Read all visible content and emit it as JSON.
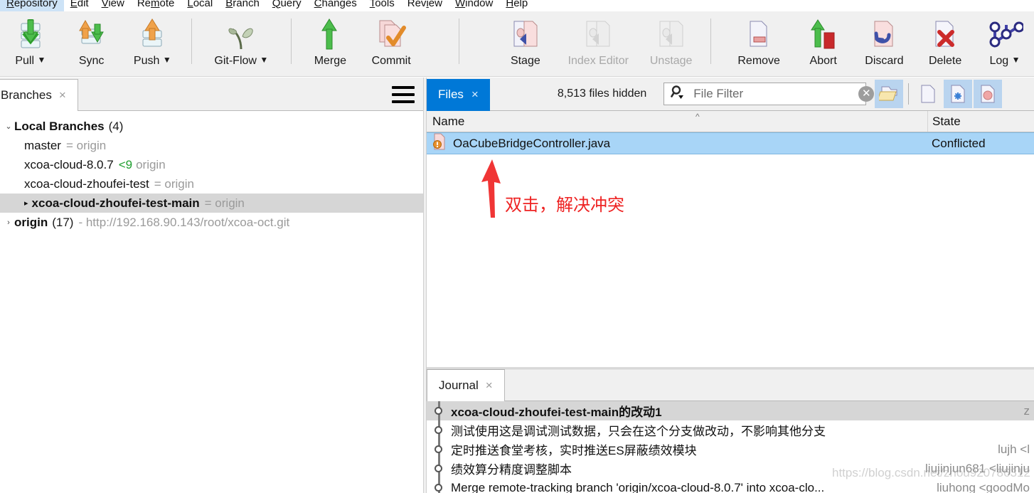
{
  "menubar": {
    "items": [
      {
        "label": "Repository",
        "mnemonic": "R",
        "active": true
      },
      {
        "label": "Edit",
        "mnemonic": "E",
        "active": false
      },
      {
        "label": "View",
        "mnemonic": "V",
        "active": false
      },
      {
        "label": "Remote",
        "mnemonic": "m",
        "active": false
      },
      {
        "label": "Local",
        "mnemonic": "L",
        "active": false
      },
      {
        "label": "Branch",
        "mnemonic": "B",
        "active": false
      },
      {
        "label": "Query",
        "mnemonic": "Q",
        "active": false
      },
      {
        "label": "Changes",
        "mnemonic": "C",
        "active": false
      },
      {
        "label": "Tools",
        "mnemonic": "T",
        "active": false
      },
      {
        "label": "Review",
        "mnemonic": "i",
        "active": false
      },
      {
        "label": "Window",
        "mnemonic": "W",
        "active": false
      },
      {
        "label": "Help",
        "mnemonic": "H",
        "active": false
      }
    ]
  },
  "toolbar": {
    "buttons": [
      {
        "label": "Pull",
        "icon": "pull-icon",
        "dropdown": true,
        "enabled": true
      },
      {
        "label": "Sync",
        "icon": "sync-icon",
        "dropdown": false,
        "enabled": true
      },
      {
        "label": "Push",
        "icon": "push-icon",
        "dropdown": true,
        "enabled": true
      },
      {
        "label": "Git-Flow",
        "icon": "git-flow-icon",
        "dropdown": true,
        "enabled": true
      },
      {
        "label": "Merge",
        "icon": "merge-icon",
        "dropdown": false,
        "enabled": true
      },
      {
        "label": "Commit",
        "icon": "commit-icon",
        "dropdown": false,
        "enabled": true
      },
      {
        "label": "Stage",
        "icon": "stage-icon",
        "dropdown": false,
        "enabled": true
      },
      {
        "label": "Index Editor",
        "icon": "index-editor-icon",
        "dropdown": false,
        "enabled": false
      },
      {
        "label": "Unstage",
        "icon": "unstage-icon",
        "dropdown": false,
        "enabled": false
      },
      {
        "label": "Remove",
        "icon": "remove-icon",
        "dropdown": false,
        "enabled": true
      },
      {
        "label": "Abort",
        "icon": "abort-icon",
        "dropdown": false,
        "enabled": true
      },
      {
        "label": "Discard",
        "icon": "discard-icon",
        "dropdown": false,
        "enabled": true
      },
      {
        "label": "Delete",
        "icon": "delete-icon",
        "dropdown": false,
        "enabled": true
      },
      {
        "label": "Log",
        "icon": "log-icon",
        "dropdown": true,
        "enabled": true
      }
    ]
  },
  "branches_panel": {
    "tab": {
      "label": "Branches",
      "close": "×"
    },
    "menu_icon": "hamburger-menu-icon",
    "groups": [
      {
        "label": "Local Branches",
        "count": "(4)",
        "expanded": true,
        "twisty": "⌄",
        "items": [
          {
            "name": "master",
            "tracking": "= origin",
            "ahead": "",
            "selected": false,
            "current": false
          },
          {
            "name": "xcoa-cloud-8.0.7",
            "tracking": "origin",
            "ahead": "<9",
            "selected": false,
            "current": false
          },
          {
            "name": "xcoa-cloud-zhoufei-test",
            "tracking": "= origin",
            "ahead": "",
            "selected": false,
            "current": false
          },
          {
            "name": "xcoa-cloud-zhoufei-test-main",
            "tracking": "= origin",
            "ahead": "",
            "selected": true,
            "current": true
          }
        ]
      }
    ],
    "remote": {
      "label": "origin",
      "count": "(17)",
      "url": "- http://192.168.90.143/root/xcoa-oct.git",
      "twisty": "›"
    }
  },
  "files_panel": {
    "tab": {
      "label": "Files",
      "close": "×"
    },
    "hidden_files": "8,513 files hidden",
    "filter": {
      "placeholder": "File Filter",
      "value": "",
      "search_icon": "search-icon",
      "clear_icon": "clear-circle-icon"
    },
    "view_buttons": [
      {
        "name": "open-folder-icon",
        "active": true
      },
      {
        "name": "blank-file-icon",
        "active": false
      },
      {
        "name": "new-file-icon",
        "active": true
      },
      {
        "name": "modified-file-icon",
        "active": true
      }
    ],
    "columns": [
      {
        "label": "Name",
        "sorted": true,
        "sort_caret": "^"
      },
      {
        "label": "State",
        "sorted": false
      }
    ],
    "rows": [
      {
        "name": "OaCubeBridgeController.java",
        "state": "Conflicted",
        "icon": "conflicted-file-icon",
        "selected": true
      }
    ],
    "scrollbar": {
      "left_arrow": "‹"
    }
  },
  "journal_panel": {
    "tab": {
      "label": "Journal",
      "close": "×"
    },
    "header_author": "z",
    "rows": [
      {
        "message": "xcoa-cloud-zhoufei-test-main的改动1",
        "author": "z",
        "selected": true
      },
      {
        "message": "测试使用这是调试测试数据，只会在这个分支做改动，不影响其他分支",
        "author": "",
        "selected": false
      },
      {
        "message": "定时推送食堂考核，实时推送ES屏蔽绩效模块",
        "author": "lujh <l",
        "selected": false
      },
      {
        "message": "绩效算分精度调整脚本",
        "author": "liujinjun681 <liujinju",
        "selected": false
      },
      {
        "message": "Merge remote-tracking branch 'origin/xcoa-cloud-8.0.7' into xcoa-clo...",
        "author": "liuhong <goodMo",
        "selected": false
      }
    ]
  },
  "annotation": {
    "text": "双击，解决冲突",
    "color": "#ee2222",
    "arrow": "up-arrow-annotation"
  },
  "watermark": {
    "text": "https://blog.csdn.net/zhou920786312"
  },
  "colors": {
    "accent_blue": "#0078d7",
    "selection_blue": "#a8d5f7",
    "selection_grey": "#d6d6d6",
    "toolbar_bg": "#f0f0f0",
    "annotation_red": "#ee2222",
    "green": "#1e9e2e"
  }
}
